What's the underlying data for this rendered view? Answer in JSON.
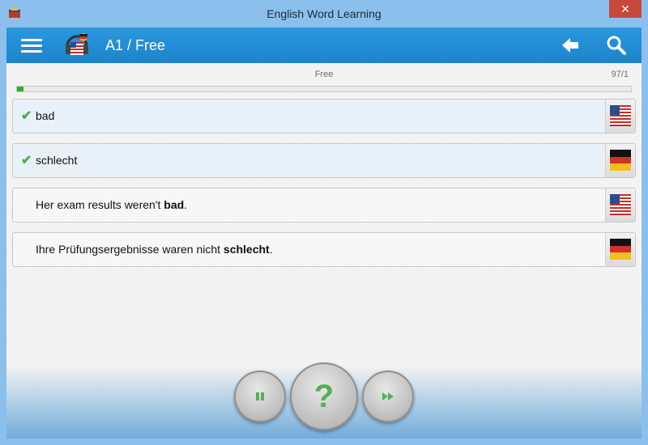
{
  "window": {
    "title": "English Word Learning",
    "close_label": "✕",
    "app_icon": "flag-app-icon"
  },
  "appbar": {
    "menu_icon": "menu-icon",
    "logo_icon": "headphones-flag-icon",
    "title": "A1 / Free",
    "back_icon": "back-arrow-icon",
    "search_icon": "search-icon"
  },
  "progress": {
    "label": "Free",
    "count": "97/1",
    "value": 0.01,
    "color": "#27b12a"
  },
  "cards": [
    {
      "type": "word",
      "checked": true,
      "text": "bad",
      "flag": "us-flag-icon"
    },
    {
      "type": "word",
      "checked": true,
      "text": "schlecht",
      "flag": "de-flag-icon"
    },
    {
      "type": "sentence",
      "text_before": "Her exam results weren't ",
      "text_bold": "bad",
      "text_after": ".",
      "flag": "us-flag-icon"
    },
    {
      "type": "sentence",
      "text_before": "Ihre Prüfungsergebnisse waren nicht ",
      "text_bold": "schlecht",
      "text_after": ".",
      "flag": "de-flag-icon"
    }
  ],
  "controls": {
    "pause_icon": "pause-icon",
    "help_label": "?",
    "next_icon": "fast-forward-icon"
  },
  "colors": {
    "accent": "#1f8ad2",
    "check": "#48b04a"
  }
}
